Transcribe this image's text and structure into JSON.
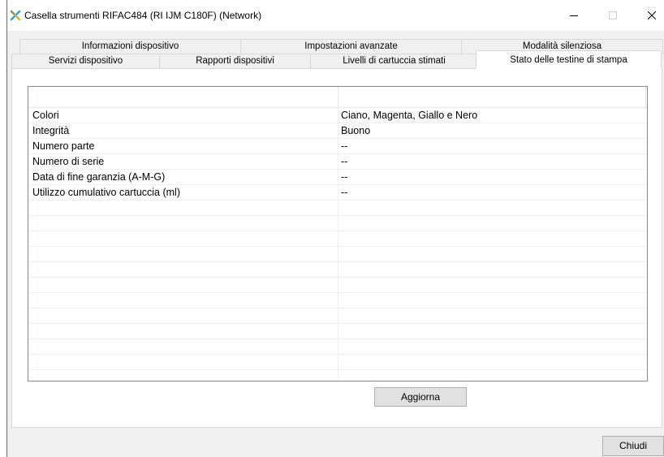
{
  "window": {
    "title": "Casella strumenti RIFAC484 (RI IJM C180F) (Network)",
    "icons": {
      "app": "tools-icon",
      "minimize": "minimize-icon",
      "maximize": "maximize-icon",
      "close": "close-icon"
    },
    "maximize_enabled": false
  },
  "tabs": {
    "row1": [
      {
        "label": "Informazioni dispositivo",
        "selected": false
      },
      {
        "label": "Impostazioni avanzate",
        "selected": false
      },
      {
        "label": "Modalità silenziosa",
        "selected": false
      }
    ],
    "row2": [
      {
        "label": "Servizi dispositivo",
        "selected": false
      },
      {
        "label": "Rapporti dispositivi",
        "selected": false
      },
      {
        "label": "Livelli di cartuccia stimati",
        "selected": false
      },
      {
        "label": "Stato delle testine di stampa",
        "selected": true
      }
    ]
  },
  "status_table": {
    "rows": [
      {
        "property": "Colori",
        "value": "Ciano, Magenta, Giallo e Nero"
      },
      {
        "property": "Integrità",
        "value": "Buono"
      },
      {
        "property": "Numero parte",
        "value": "--"
      },
      {
        "property": "Numero di serie",
        "value": "--"
      },
      {
        "property": "Data di fine garanzia (A-M-G)",
        "value": "--"
      },
      {
        "property": "Utilizzo cumulativo cartuccia (ml)",
        "value": "--"
      }
    ]
  },
  "buttons": {
    "refresh": "Aggiorna",
    "close": "Chiudi"
  },
  "colors": {
    "window_background": "#f0f0f0",
    "panel_background": "#ffffff",
    "grid_line": "#f0f0f0",
    "list_border": "#828790",
    "button_face": "#e1e1e1",
    "button_border": "#adadad",
    "tab_border": "#d9d9d9",
    "disabled_glyph": "#cccccc"
  }
}
